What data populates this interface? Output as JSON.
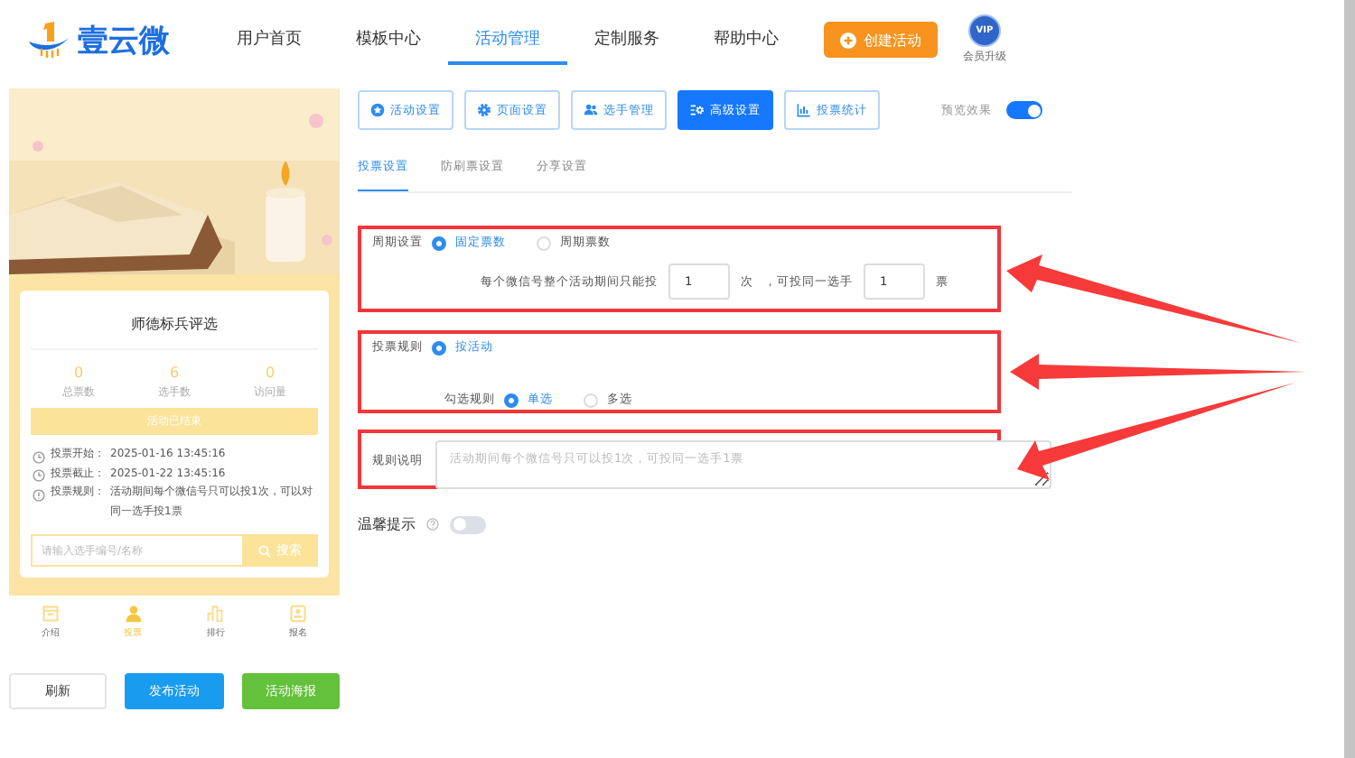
{
  "header": {
    "logo": "壹云微",
    "nav": [
      {
        "label": "用户首页",
        "selected": false
      },
      {
        "label": "模板中心",
        "selected": false
      },
      {
        "label": "活动管理",
        "selected": true
      },
      {
        "label": "定制服务",
        "selected": false
      },
      {
        "label": "帮助中心",
        "selected": false
      }
    ],
    "create_button": "创建活动",
    "vip_badge": "VIP",
    "vip_label": "会员升级"
  },
  "preview": {
    "title": "师德标兵评选",
    "stats": [
      {
        "value": "0",
        "label": "总票数"
      },
      {
        "value": "6",
        "label": "选手数"
      },
      {
        "value": "0",
        "label": "访问量"
      }
    ],
    "status": "活动已结束",
    "info": [
      {
        "kind": "clock",
        "label": "投票开始：",
        "text": "2025-01-16 13:45:16"
      },
      {
        "kind": "clock",
        "label": "投票截止：",
        "text": "2025-01-22 13:45:16"
      },
      {
        "kind": "info",
        "label": "投票规则：",
        "text": "活动期间每个微信号只可以投1次，可以对同一选手投1票"
      }
    ],
    "search": {
      "placeholder": "请输入选手编号/名称",
      "button": "搜索"
    },
    "tabs": [
      {
        "label": "介绍",
        "kind": "intro",
        "selected": false
      },
      {
        "label": "投票",
        "kind": "person",
        "selected": true
      },
      {
        "label": "排行",
        "kind": "chart",
        "selected": false
      },
      {
        "label": "报名",
        "kind": "badge",
        "selected": false
      }
    ],
    "actions": [
      {
        "label": "刷新",
        "kind": "plain"
      },
      {
        "label": "发布活动",
        "kind": "blue"
      },
      {
        "label": "活动海报",
        "kind": "green"
      }
    ]
  },
  "toolbar": [
    {
      "label": "活动设置",
      "kind": "star",
      "selected": false
    },
    {
      "label": "页面设置",
      "kind": "gear",
      "selected": false
    },
    {
      "label": "选手管理",
      "kind": "users",
      "selected": false
    },
    {
      "label": "高级设置",
      "kind": "sliders",
      "selected": true
    },
    {
      "label": "投票统计",
      "kind": "chart",
      "selected": false
    }
  ],
  "preview_toggle": {
    "label": "预览效果",
    "on": true
  },
  "subtabs": [
    {
      "label": "投票设置",
      "selected": true
    },
    {
      "label": "防刷票设置",
      "selected": false
    },
    {
      "label": "分享设置",
      "selected": false
    }
  ],
  "period": {
    "label": "周期设置",
    "options": [
      {
        "label": "固定票数",
        "selected": true
      },
      {
        "label": "周期票数",
        "selected": false
      }
    ],
    "text_before": "每个微信号整个活动期间只能投",
    "times": "1",
    "unit_times": "次",
    "text_mid": "，可投同一选手",
    "votes": "1",
    "unit_votes": "票"
  },
  "vote_rule": {
    "label": "投票规则",
    "options": [
      {
        "label": "按活动",
        "selected": true
      }
    ],
    "choice_label": "勾选规则",
    "choices": [
      {
        "label": "单选",
        "selected": true
      },
      {
        "label": "多选",
        "selected": false
      }
    ]
  },
  "rule_note": {
    "label": "规则说明",
    "placeholder": "活动期间每个微信号只可以投1次，可投同一选手1票"
  },
  "tip": {
    "label": "温馨提示",
    "on": false
  }
}
